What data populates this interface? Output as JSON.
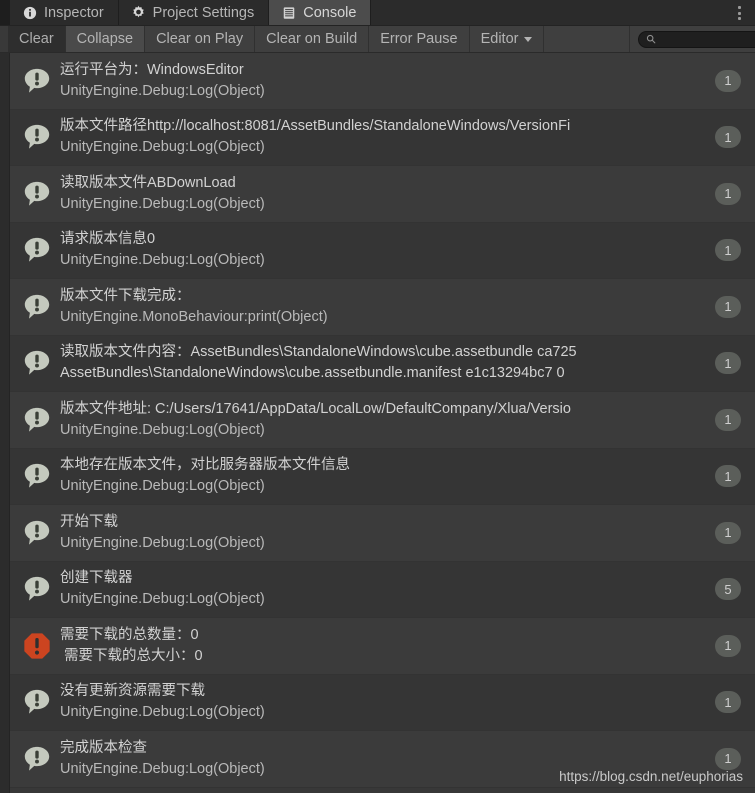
{
  "window": {
    "tabs": [
      {
        "label": "Inspector",
        "icon": "info-icon",
        "active": false
      },
      {
        "label": "Project Settings",
        "icon": "gear-icon",
        "active": false
      },
      {
        "label": "Console",
        "icon": "console-icon",
        "active": true
      }
    ],
    "overflow_menu_icon": "kebab-menu-icon"
  },
  "toolbar": {
    "clear_label": "Clear",
    "collapse_label": "Collapse",
    "clear_on_play_label": "Clear on Play",
    "clear_on_build_label": "Clear on Build",
    "error_pause_label": "Error Pause",
    "editor_label": "Editor",
    "search": {
      "value": "",
      "placeholder": "",
      "icon": "search-icon"
    }
  },
  "console": {
    "entries": [
      {
        "type": "log",
        "icon": "log-icon",
        "message": "运行平台为：WindowsEditor",
        "stacktrace": "UnityEngine.Debug:Log(Object)",
        "count": "1"
      },
      {
        "type": "log",
        "icon": "log-icon",
        "message": "版本文件路径http://localhost:8081/AssetBundles/StandaloneWindows/VersionFi",
        "stacktrace": "UnityEngine.Debug:Log(Object)",
        "count": "1"
      },
      {
        "type": "log",
        "icon": "log-icon",
        "message": "读取版本文件ABDownLoad",
        "stacktrace": "UnityEngine.Debug:Log(Object)",
        "count": "1"
      },
      {
        "type": "log",
        "icon": "log-icon",
        "message": "请求版本信息0",
        "stacktrace": "UnityEngine.Debug:Log(Object)",
        "count": "1"
      },
      {
        "type": "log",
        "icon": "log-icon",
        "message": "版本文件下载完成：",
        "stacktrace": "UnityEngine.MonoBehaviour:print(Object)",
        "count": "1"
      },
      {
        "type": "log",
        "icon": "log-icon",
        "message": "读取版本文件内容：AssetBundles\\StandaloneWindows\\cube.assetbundle ca725",
        "stacktrace": "AssetBundles\\StandaloneWindows\\cube.assetbundle.manifest e1c13294bc7 0",
        "second_line_is_message": true,
        "count": "1"
      },
      {
        "type": "log",
        "icon": "log-icon",
        "message": "版本文件地址: C:/Users/17641/AppData/LocalLow/DefaultCompany/Xlua/Versio",
        "stacktrace": "UnityEngine.Debug:Log(Object)",
        "count": "1"
      },
      {
        "type": "log",
        "icon": "log-icon",
        "message": "本地存在版本文件，对比服务器版本文件信息",
        "stacktrace": "UnityEngine.Debug:Log(Object)",
        "count": "1"
      },
      {
        "type": "log",
        "icon": "log-icon",
        "message": "开始下载",
        "stacktrace": "UnityEngine.Debug:Log(Object)",
        "count": "1"
      },
      {
        "type": "log",
        "icon": "log-icon",
        "message": "创建下载器",
        "stacktrace": "UnityEngine.Debug:Log(Object)",
        "count": "5"
      },
      {
        "type": "error",
        "icon": "error-icon",
        "message": "需要下载的总数量：0",
        "stacktrace": " 需要下载的总大小：0",
        "second_line_is_message": true,
        "count": "1"
      },
      {
        "type": "log",
        "icon": "log-icon",
        "message": "没有更新资源需要下载",
        "stacktrace": "UnityEngine.Debug:Log(Object)",
        "count": "1"
      },
      {
        "type": "log",
        "icon": "log-icon",
        "message": "完成版本检查",
        "stacktrace": "UnityEngine.Debug:Log(Object)",
        "count": "1"
      }
    ]
  },
  "watermark": "https://blog.csdn.net/euphorias",
  "colors": {
    "error_icon": "#cc4420",
    "log_icon": "#c4c9be",
    "active_tab_bg": "#4c4c4c",
    "panel_bg": "#383838"
  }
}
